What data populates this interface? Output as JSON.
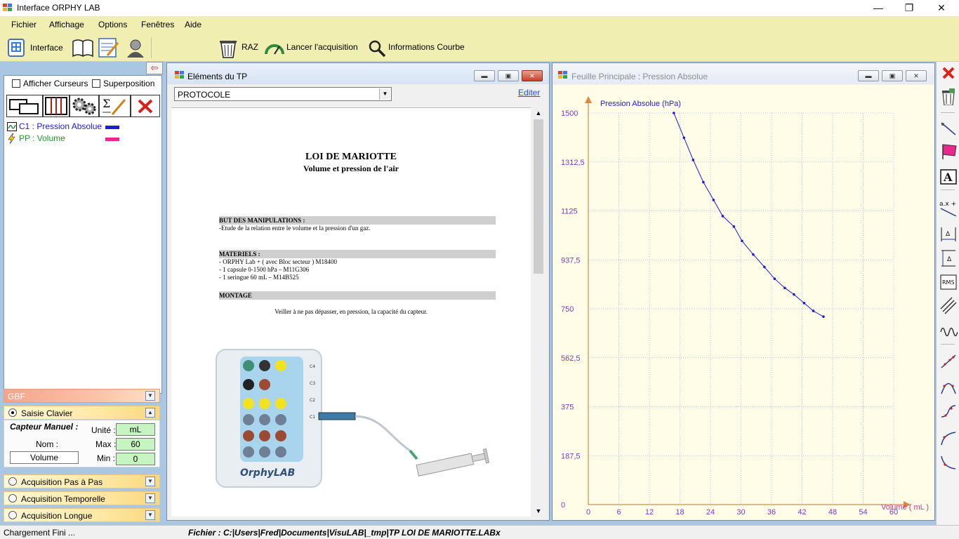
{
  "window": {
    "title": "Interface ORPHY LAB",
    "min": "—",
    "max": "❐",
    "close": "✕"
  },
  "menu": {
    "items": [
      "Fichier",
      "Affichage",
      "Options",
      "Fenêtres",
      "Aide"
    ]
  },
  "toolbar": {
    "interface_label": "Interface",
    "raz_label": "RAZ",
    "acquisition_label": "Lancer l'acquisition",
    "info_label": "Informations Courbe"
  },
  "leftpanel": {
    "collapse_arrow": "⇦",
    "afficher_curseurs": "Afficher Curseurs",
    "superposition": "Superposition",
    "curves": [
      {
        "label": "C1 : Pression Absolue",
        "color": "#1c1cd6"
      },
      {
        "label": "PP : Volume",
        "color": "#e8288c"
      }
    ],
    "gbf": "GBF",
    "saisie_clavier": "Saisie Clavier",
    "capteur_manuel": "Capteur Manuel :",
    "unite_label": "Unité :",
    "unite_value": "mL",
    "nom_label": "Nom :",
    "nom_value": "Volume",
    "max_label": "Max :",
    "max_value": "60",
    "min_label": "Min :",
    "min_value": "0",
    "acq_pas": "Acquisition Pas à  Pas",
    "acq_temp": "Acquisition Temporelle",
    "acq_longue": "Acquisition Longue"
  },
  "docwindow": {
    "title": "Eléments du TP",
    "select_value": "PROTOCOLE",
    "edit_link": "Editer",
    "heading1": "LOI DE MARIOTTE",
    "heading2": "Volume et pression de l'air",
    "but_title": "BUT DES MANIPULATIONS :",
    "but_text": "-Etude de la relation entre le volume et la pression d'un gaz.",
    "materiels_title": "MATERIELS :",
    "materiels": [
      "- ORPHY Lab + ( avec Bloc secteur ) M18400",
      "- 1 capsule 0-1500 hPa – M11G306",
      "- 1 seringue 60 mL – M14B525"
    ],
    "montage_title": "MONTAGE",
    "montage_text": "Veiller à ne pas dépasser, en pression, la capacité du capteur.",
    "device_ports": [
      "C4",
      "C3",
      "C2",
      "C1"
    ],
    "device_brand": "OrphyLAB"
  },
  "graphwindow": {
    "title": "Feuille Principale :  Pression Absolue"
  },
  "chart_data": {
    "type": "scatter",
    "title": "",
    "ylabel": "Pression Absolue (hPa)",
    "xlabel": "Volume ( mL )",
    "xlim": [
      0,
      60
    ],
    "ylim": [
      0,
      1500
    ],
    "xticks": [
      "0",
      "6",
      "12",
      "18",
      "24",
      "30",
      "36",
      "42",
      "48",
      "54",
      "60"
    ],
    "yticks": [
      "0",
      "187,5",
      "375",
      "562,5",
      "750",
      "937,5",
      "1125",
      "1312,5",
      "1500"
    ],
    "grid": true,
    "series": [
      {
        "color": "#1c1cd6",
        "x": [
          16.8,
          18.8,
          20.6,
          22.6,
          24.6,
          26.4,
          28.6,
          30.2,
          32.4,
          34.6,
          36.6,
          38.6,
          40.4,
          42.4,
          44.2,
          46.2
        ],
        "y": [
          1500,
          1405,
          1320,
          1235,
          1167,
          1105,
          1065,
          1010,
          958,
          910,
          865,
          830,
          805,
          772,
          742,
          720
        ]
      }
    ]
  },
  "status": {
    "left": "Chargement Fini ...",
    "file": "Fichier : C:|Users|Fred|Documents|VisuLAB|_tmp|TP LOI DE MARIOTTE.LABx"
  }
}
